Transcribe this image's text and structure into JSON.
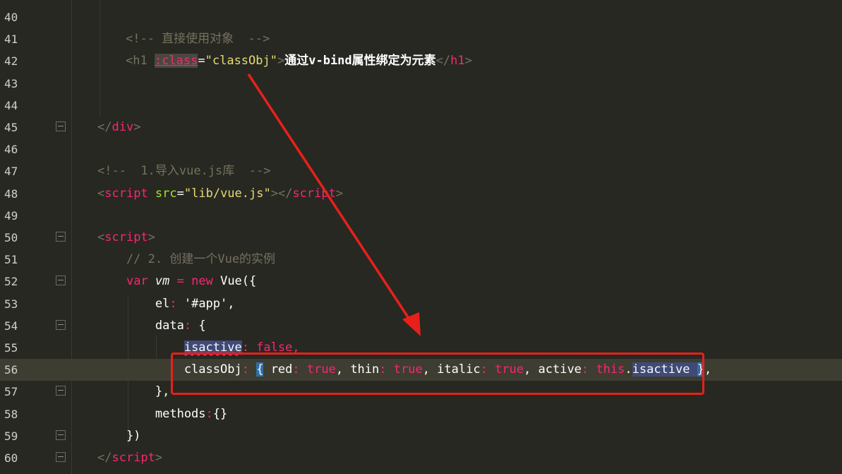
{
  "editor": {
    "current_line": 56,
    "lines": [
      {
        "n": "40",
        "segments": []
      },
      {
        "n": "41",
        "segments": [
          {
            "t": "<!-- 直接使用对象  -->",
            "c": "c-comment"
          }
        ]
      },
      {
        "n": "42",
        "segments": [
          {
            "t": "<h1 ",
            "c": "c-comment"
          },
          {
            "t": ":class",
            "c": "hl-class"
          },
          {
            "t": "=",
            "c": "c-white"
          },
          {
            "t": "\"classObj\"",
            "c": "c-str"
          },
          {
            "t": ">",
            "c": "c-comment"
          },
          {
            "t": "通过v-bind属性绑定为元素",
            "c": "c-bold"
          },
          {
            "t": "</",
            "c": "c-comment"
          },
          {
            "t": "h1",
            "c": "c-tag"
          },
          {
            "t": ">",
            "c": "c-comment"
          }
        ]
      },
      {
        "n": "43",
        "segments": []
      },
      {
        "n": "44",
        "segments": []
      },
      {
        "n": "45",
        "segments": [
          {
            "t": "</",
            "c": "c-comment"
          },
          {
            "t": "div",
            "c": "c-tag"
          },
          {
            "t": ">",
            "c": "c-comment"
          }
        ]
      },
      {
        "n": "46",
        "segments": []
      },
      {
        "n": "47",
        "segments": [
          {
            "t": "<!--  1.导入vue.js库  -->",
            "c": "c-comment"
          }
        ]
      },
      {
        "n": "48",
        "segments": [
          {
            "t": "<",
            "c": "c-comment"
          },
          {
            "t": "script",
            "c": "c-tag"
          },
          {
            "t": " ",
            "c": "c-white"
          },
          {
            "t": "src",
            "c": "c-attr"
          },
          {
            "t": "=",
            "c": "c-white"
          },
          {
            "t": "\"lib/vue.js\"",
            "c": "c-str"
          },
          {
            "t": "></",
            "c": "c-comment"
          },
          {
            "t": "script",
            "c": "c-tag"
          },
          {
            "t": ">",
            "c": "c-comment"
          }
        ]
      },
      {
        "n": "49",
        "segments": []
      },
      {
        "n": "50",
        "segments": [
          {
            "t": "<",
            "c": "c-comment"
          },
          {
            "t": "script",
            "c": "c-tag"
          },
          {
            "t": ">",
            "c": "c-comment"
          }
        ]
      },
      {
        "n": "51",
        "segments": [
          {
            "t": "    // 2. 创建一个Vue的实例",
            "c": "c-comment"
          }
        ]
      },
      {
        "n": "52",
        "segments": [
          {
            "t": "    ",
            "c": "c-white"
          },
          {
            "t": "var",
            "c": "c-kw"
          },
          {
            "t": " ",
            "c": "c-white"
          },
          {
            "t": "vm",
            "c": "c-var"
          },
          {
            "t": " = ",
            "c": "c-punc"
          },
          {
            "t": "new",
            "c": "c-kw"
          },
          {
            "t": " Vue({",
            "c": "c-white"
          }
        ]
      },
      {
        "n": "53",
        "segments": [
          {
            "t": "        el",
            "c": "c-white"
          },
          {
            "t": ":",
            "c": "c-punc"
          },
          {
            "t": " '#app',",
            "c": "c-white"
          }
        ]
      },
      {
        "n": "54",
        "segments": [
          {
            "t": "        data",
            "c": "c-white"
          },
          {
            "t": ":",
            "c": "c-punc"
          },
          {
            "t": " {",
            "c": "c-white"
          }
        ]
      },
      {
        "n": "55",
        "segments": [
          {
            "t": "            ",
            "c": "c-white"
          },
          {
            "t": "isactive",
            "c": "hl-blue squiggle"
          },
          {
            "t": ": false,",
            "c": "c-bool"
          }
        ]
      },
      {
        "n": "56",
        "segments": [
          {
            "t": "            classObj",
            "c": "c-white"
          },
          {
            "t": ":",
            "c": "c-punc"
          },
          {
            "t": " ",
            "c": "c-white"
          },
          {
            "t": "{",
            "c": "hl-brace"
          },
          {
            "t": " red",
            "c": "c-white"
          },
          {
            "t": ":",
            "c": "c-punc"
          },
          {
            "t": " true",
            "c": "c-bool"
          },
          {
            "t": ", thin",
            "c": "c-white"
          },
          {
            "t": ":",
            "c": "c-punc"
          },
          {
            "t": " true",
            "c": "c-bool"
          },
          {
            "t": ", italic",
            "c": "c-white"
          },
          {
            "t": ":",
            "c": "c-punc"
          },
          {
            "t": " true",
            "c": "c-bool"
          },
          {
            "t": ", active",
            "c": "c-white"
          },
          {
            "t": ":",
            "c": "c-punc"
          },
          {
            "t": " this",
            "c": "c-bool"
          },
          {
            "t": ".",
            "c": "c-white"
          },
          {
            "t": "isactive ",
            "c": "hl-blue"
          },
          {
            "t": "}",
            "c": "hl-brace"
          },
          {
            "t": ",",
            "c": "c-white"
          }
        ]
      },
      {
        "n": "57",
        "segments": [
          {
            "t": "        },",
            "c": "c-white"
          }
        ]
      },
      {
        "n": "58",
        "segments": [
          {
            "t": "        methods",
            "c": "c-white"
          },
          {
            "t": ":",
            "c": "c-punc"
          },
          {
            "t": "{}",
            "c": "c-white"
          }
        ]
      },
      {
        "n": "59",
        "segments": [
          {
            "t": "    })",
            "c": "c-white"
          }
        ]
      },
      {
        "n": "60",
        "segments": [
          {
            "t": "</",
            "c": "c-comment"
          },
          {
            "t": "script",
            "c": "c-tag"
          },
          {
            "t": ">",
            "c": "c-comment"
          }
        ]
      }
    ]
  },
  "annotation": {
    "arrow_color": "#e8201a",
    "box_color": "#e8201a"
  }
}
